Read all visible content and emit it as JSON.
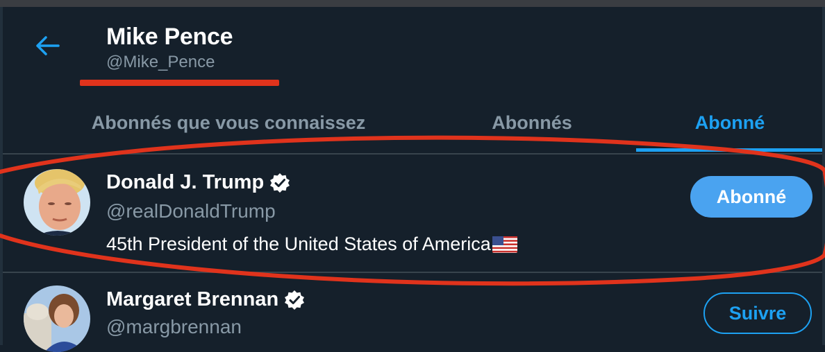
{
  "profile": {
    "name": "Mike Pence",
    "handle": "@Mike_Pence"
  },
  "tabs": [
    {
      "label": "Abonnés que vous connaissez",
      "active": false
    },
    {
      "label": "Abonnés",
      "active": false
    },
    {
      "label": "Abonné",
      "active": true
    }
  ],
  "users": [
    {
      "name": "Donald J. Trump",
      "handle": "@realDonaldTrump",
      "bio": "45th President of the United States of America",
      "bio_icon": "us-flag-icon",
      "verified": true,
      "button": "Abonné"
    },
    {
      "name": "Margaret Brennan",
      "handle": "@margbrennan",
      "verified": true,
      "button": "Suivre"
    }
  ],
  "colors": {
    "background": "#15202b",
    "accent": "#1da1f2",
    "secondary_text": "#8899a6",
    "annotation_red": "#e0331c"
  },
  "icons": [
    "back-arrow-icon",
    "verified-badge-icon",
    "us-flag-icon"
  ]
}
